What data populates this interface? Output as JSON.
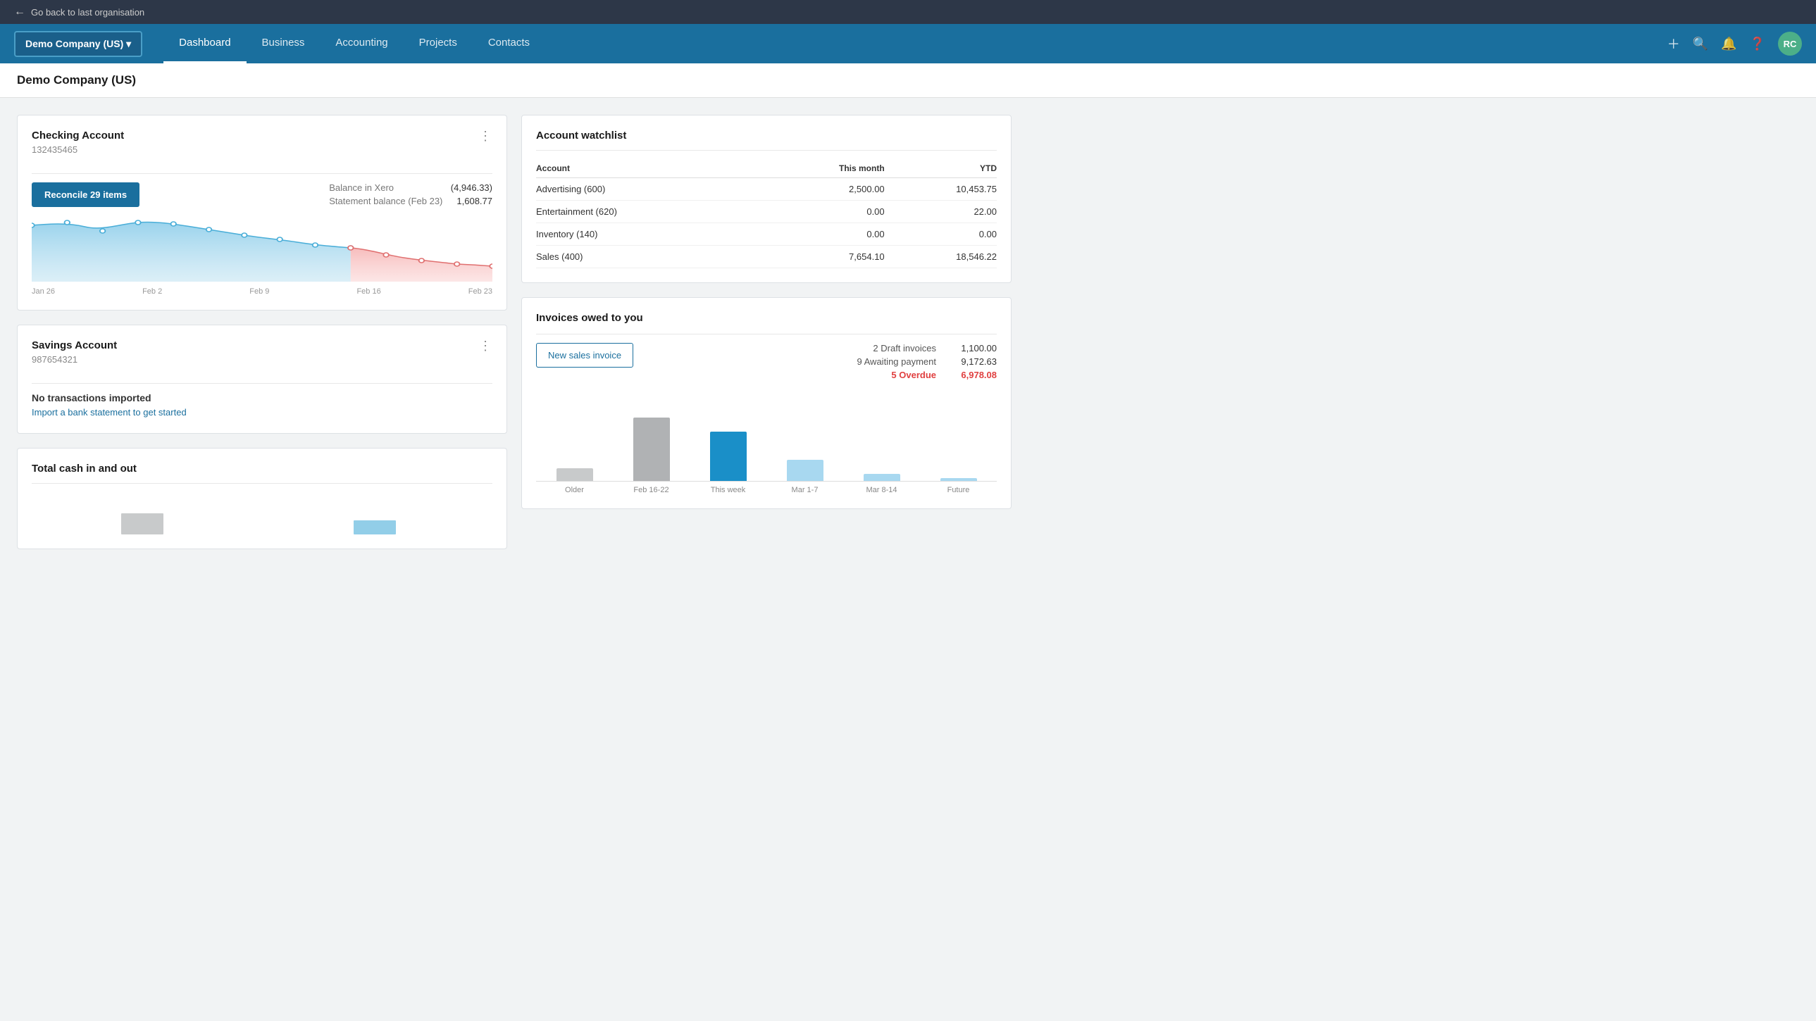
{
  "topbar": {
    "back_label": "Go back to last organisation"
  },
  "nav": {
    "brand": "Demo Company (US)",
    "brand_chevron": "▾",
    "links": [
      {
        "label": "Dashboard",
        "active": true
      },
      {
        "label": "Business",
        "active": false
      },
      {
        "label": "Accounting",
        "active": false
      },
      {
        "label": "Projects",
        "active": false
      },
      {
        "label": "Contacts",
        "active": false
      }
    ],
    "avatar_initials": "RC"
  },
  "page": {
    "title": "Demo Company (US)"
  },
  "checking_account": {
    "title": "Checking Account",
    "number": "132435465",
    "reconcile_btn": "Reconcile 29 items",
    "balance_in_xero_label": "Balance in Xero",
    "balance_in_xero_value": "(4,946.33)",
    "statement_balance_label": "Statement balance (Feb 23)",
    "statement_balance_value": "1,608.77",
    "chart_labels": [
      "Jan 26",
      "Feb 2",
      "Feb 9",
      "Feb 16",
      "Feb 23"
    ]
  },
  "savings_account": {
    "title": "Savings Account",
    "number": "987654321",
    "no_transactions": "No transactions imported",
    "import_link": "Import a bank statement to get started"
  },
  "total_cash": {
    "title": "Total cash in and out"
  },
  "watchlist": {
    "title": "Account watchlist",
    "col_account": "Account",
    "col_this_month": "This month",
    "col_ytd": "YTD",
    "rows": [
      {
        "account": "Advertising (600)",
        "this_month": "2,500.00",
        "ytd": "10,453.75"
      },
      {
        "account": "Entertainment (620)",
        "this_month": "0.00",
        "ytd": "22.00"
      },
      {
        "account": "Inventory (140)",
        "this_month": "0.00",
        "ytd": "0.00"
      },
      {
        "account": "Sales (400)",
        "this_month": "7,654.10",
        "ytd": "18,546.22"
      }
    ]
  },
  "invoices": {
    "title": "Invoices owed to you",
    "new_btn": "New sales invoice",
    "draft_label": "2 Draft invoices",
    "draft_value": "1,100.00",
    "awaiting_label": "9 Awaiting payment",
    "awaiting_value": "9,172.63",
    "overdue_label": "5 Overdue",
    "overdue_value": "6,978.08",
    "chart_bars": [
      {
        "label": "Older",
        "height": 18,
        "color": "gray"
      },
      {
        "label": "Feb 16-22",
        "height": 90,
        "color": "gray-dark"
      },
      {
        "label": "This week",
        "height": 70,
        "color": "blue"
      },
      {
        "label": "Mar 1-7",
        "height": 30,
        "color": "blue-light"
      },
      {
        "label": "Mar 8-14",
        "height": 10,
        "color": "blue-light"
      },
      {
        "label": "Future",
        "height": 4,
        "color": "blue-light"
      }
    ]
  }
}
